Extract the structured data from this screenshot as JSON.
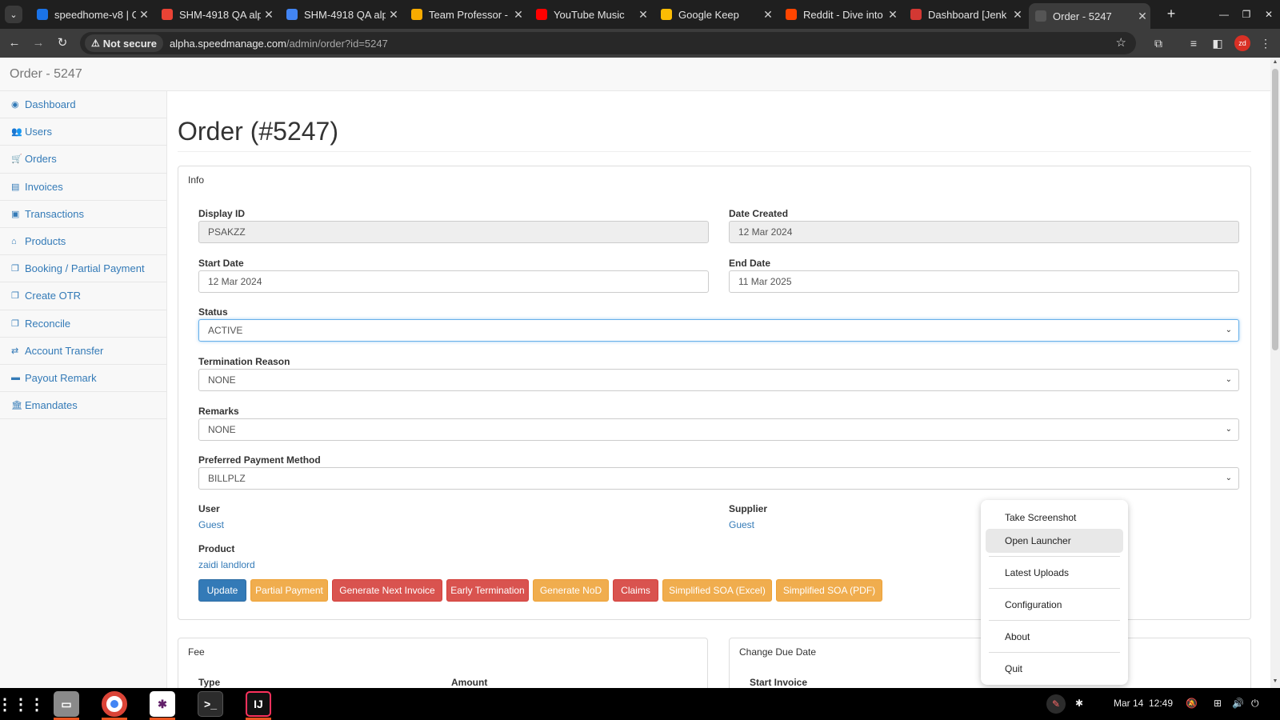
{
  "browser": {
    "tabs": [
      {
        "title": "speedhome-v8 | C",
        "color": "#1a73e8"
      },
      {
        "title": "SHM-4918 QA alp",
        "color": "#ea4335"
      },
      {
        "title": "SHM-4918 QA alp",
        "color": "#4285f4"
      },
      {
        "title": "Team Professor -",
        "color": "#f9ab00"
      },
      {
        "title": "YouTube Music",
        "color": "#ff0000"
      },
      {
        "title": "Google Keep",
        "color": "#fbbc04"
      },
      {
        "title": "Reddit - Dive into",
        "color": "#ff4500"
      },
      {
        "title": "Dashboard [Jenk",
        "color": "#d33833"
      },
      {
        "title": "Order - 5247",
        "color": "#555555"
      }
    ],
    "not_secure": "Not secure",
    "url_host": "alpha.speedmanage.com",
    "url_path": "/admin/order?id=5247",
    "profile_initials": "zd"
  },
  "page": {
    "brand": "Order - 5247",
    "title": "Order (#5247)",
    "sidebar": [
      {
        "label": "Dashboard",
        "icon": "tachometer-icon",
        "glyph": "◉"
      },
      {
        "label": "Users",
        "icon": "users-icon",
        "glyph": "👥"
      },
      {
        "label": "Orders",
        "icon": "cart-icon",
        "glyph": "🛒"
      },
      {
        "label": "Invoices",
        "icon": "list-icon",
        "glyph": "▤"
      },
      {
        "label": "Transactions",
        "icon": "money-icon",
        "glyph": "▣"
      },
      {
        "label": "Products",
        "icon": "home-icon",
        "glyph": "⌂"
      },
      {
        "label": "Booking / Partial Payment",
        "icon": "copy-icon",
        "glyph": "❐"
      },
      {
        "label": "Create OTR",
        "icon": "copy-icon",
        "glyph": "❐"
      },
      {
        "label": "Reconcile",
        "icon": "copy-icon",
        "glyph": "❐"
      },
      {
        "label": "Account Transfer",
        "icon": "exchange-icon",
        "glyph": "⇄"
      },
      {
        "label": "Payout Remark",
        "icon": "credit-card-icon",
        "glyph": "▬"
      },
      {
        "label": "Emandates",
        "icon": "bank-icon",
        "glyph": "🏛"
      }
    ],
    "info": {
      "panel_title": "Info",
      "display_id_label": "Display ID",
      "display_id": "PSAKZZ",
      "date_created_label": "Date Created",
      "date_created": "12 Mar 2024",
      "start_date_label": "Start Date",
      "start_date": "12 Mar 2024",
      "end_date_label": "End Date",
      "end_date": "11 Mar 2025",
      "status_label": "Status",
      "status": "ACTIVE",
      "termination_label": "Termination Reason",
      "termination": "NONE",
      "remarks_label": "Remarks",
      "remarks": "NONE",
      "payment_label": "Preferred Payment Method",
      "payment": "BILLPLZ",
      "user_label": "User",
      "user": "Guest",
      "supplier_label": "Supplier",
      "supplier": "Guest",
      "product_label": "Product",
      "product": "zaidi landlord"
    },
    "buttons": [
      {
        "label": "Update",
        "style": "primary"
      },
      {
        "label": "Partial Payment",
        "style": "warning"
      },
      {
        "label": "Generate Next Invoice",
        "style": "danger"
      },
      {
        "label": "Early Termination",
        "style": "danger"
      },
      {
        "label": "Generate NoD",
        "style": "warning"
      },
      {
        "label": "Claims",
        "style": "danger"
      },
      {
        "label": "Simplified SOA (Excel)",
        "style": "warning"
      },
      {
        "label": "Simplified SOA (PDF)",
        "style": "warning"
      }
    ],
    "fee": {
      "panel_title": "Fee",
      "col_type": "Type",
      "col_amount": "Amount"
    },
    "due": {
      "panel_title": "Change Due Date",
      "start_invoice": "Start Invoice"
    }
  },
  "context_menu": [
    {
      "label": "Take Screenshot"
    },
    {
      "label": "Open Launcher"
    },
    {
      "label": "Latest Uploads"
    },
    {
      "label": "Configuration"
    },
    {
      "label": "About"
    },
    {
      "label": "Quit"
    }
  ],
  "taskbar": {
    "date": "Mar 14",
    "time": "12:49"
  }
}
